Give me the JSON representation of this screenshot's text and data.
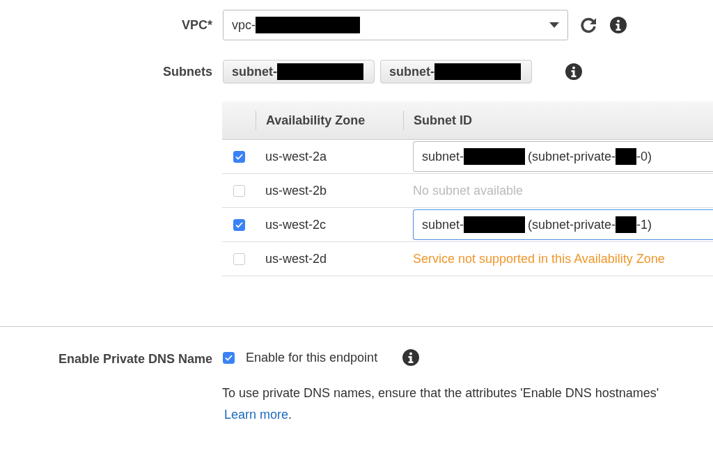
{
  "vpc": {
    "label": "VPC*",
    "value": [
      {
        "kind": "text",
        "text": "vpc-"
      },
      {
        "kind": "redacted"
      }
    ]
  },
  "subnets": {
    "label": "Subnets",
    "tokens": [
      [
        {
          "kind": "text",
          "text": "subnet-"
        },
        {
          "kind": "redacted"
        }
      ],
      [
        {
          "kind": "text",
          "text": "subnet-"
        },
        {
          "kind": "redacted"
        }
      ]
    ]
  },
  "table": {
    "columns": [
      "Availability Zone",
      "Subnet ID"
    ],
    "rows": [
      {
        "checked": true,
        "zone": "us-west-2a",
        "kind": "field",
        "focused": false,
        "value": [
          {
            "kind": "text",
            "text": "subnet-"
          },
          {
            "kind": "redacted"
          },
          {
            "kind": "text",
            "text": "(subnet-private-"
          },
          {
            "kind": "redacted"
          },
          {
            "kind": "text",
            "text": "-0)"
          }
        ]
      },
      {
        "checked": false,
        "zone": "us-west-2b",
        "kind": "note",
        "text": "No subnet available"
      },
      {
        "checked": true,
        "zone": "us-west-2c",
        "kind": "field",
        "focused": true,
        "value": [
          {
            "kind": "text",
            "text": "subnet-"
          },
          {
            "kind": "redacted"
          },
          {
            "kind": "text",
            "text": "(subnet-private-"
          },
          {
            "kind": "redacted"
          },
          {
            "kind": "text",
            "text": "-1)"
          }
        ]
      },
      {
        "checked": false,
        "zone": "us-west-2d",
        "kind": "warning",
        "text": "Service not supported in this Availability Zone"
      }
    ]
  },
  "private_dns": {
    "label": "Enable Private DNS Name",
    "checked": true,
    "option": "Enable for this endpoint",
    "description": "To use private DNS names, ensure that the attributes 'Enable DNS hostnames'",
    "link": "Learn more",
    "link_suffix": "."
  }
}
